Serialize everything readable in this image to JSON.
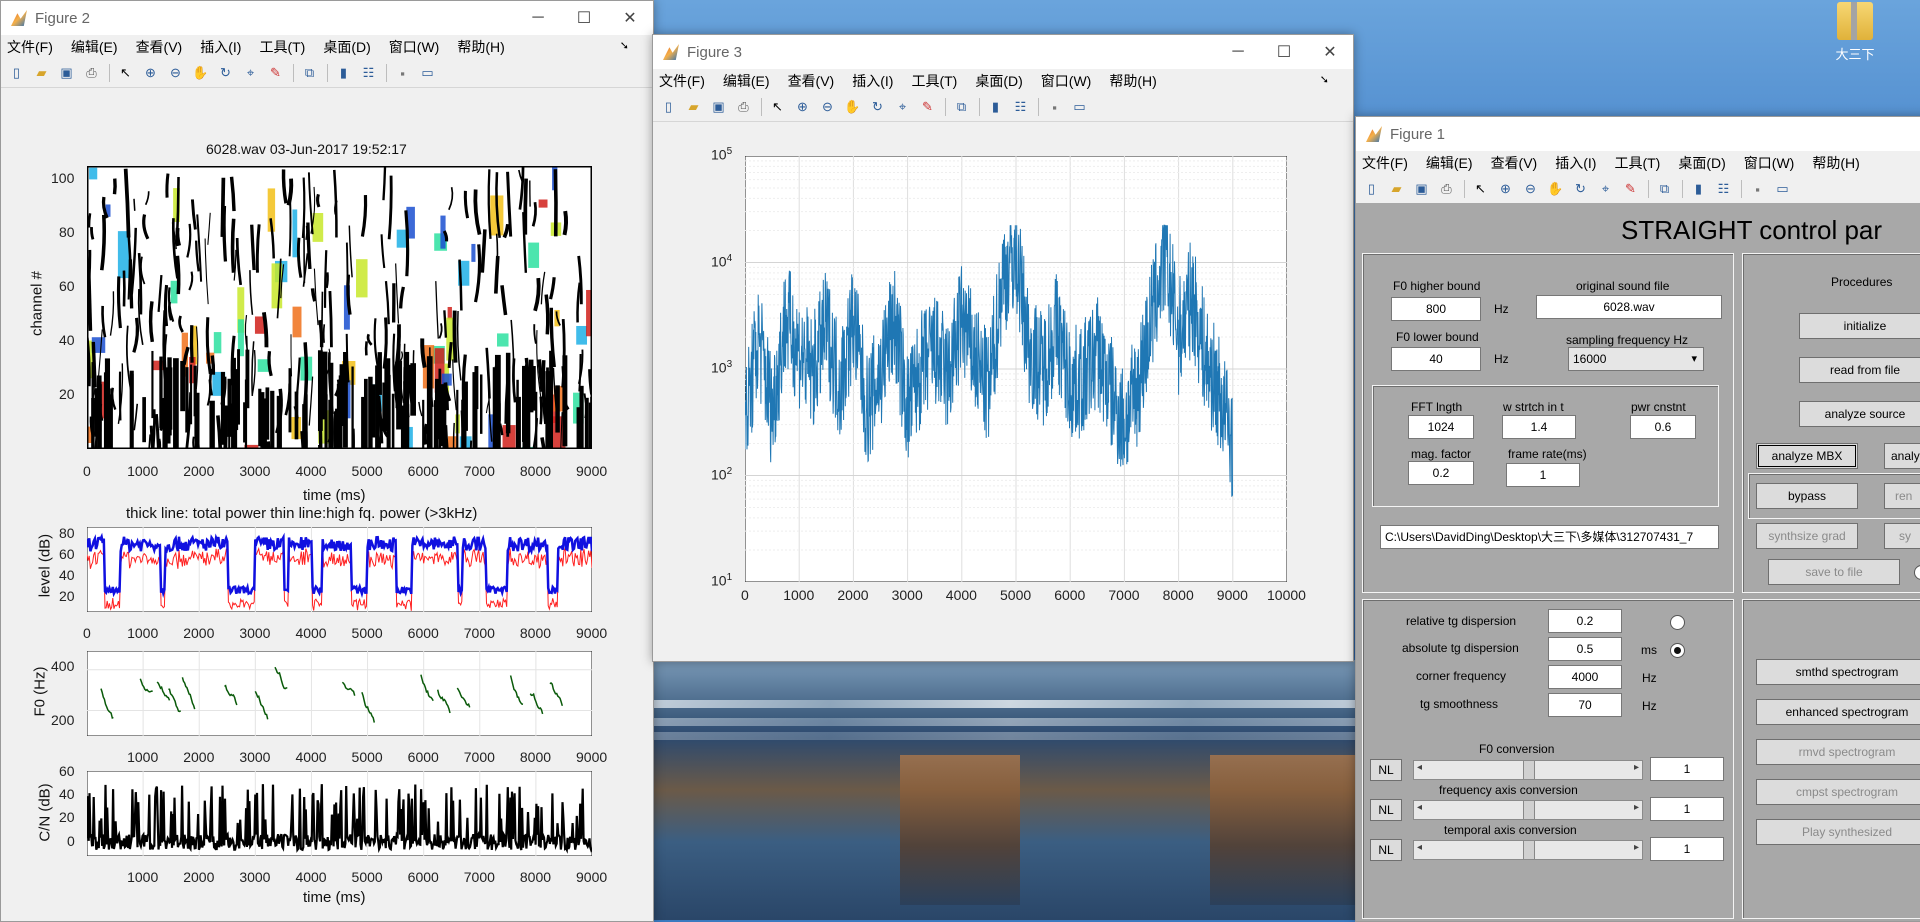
{
  "desktop": {
    "icon_label": "大三下"
  },
  "menus": [
    "文件(F)",
    "编辑(E)",
    "查看(V)",
    "插入(I)",
    "工具(T)",
    "桌面(D)",
    "窗口(W)",
    "帮助(H)"
  ],
  "figure2": {
    "title": "Figure 2",
    "spectrogram": {
      "title": "6028.wav  03-Jun-2017 19:52:17",
      "ylabel": "channel #",
      "xlabel": "time (ms)",
      "yticks": [
        "100",
        "80",
        "60",
        "40",
        "20"
      ],
      "xticks": [
        "0",
        "1000",
        "2000",
        "3000",
        "4000",
        "5000",
        "6000",
        "7000",
        "8000",
        "9000"
      ]
    },
    "power": {
      "title": "thick line: total power thin line:high fq. power (>3kHz)",
      "ylabel": "level (dB)",
      "yticks": [
        "80",
        "60",
        "40",
        "20"
      ],
      "xticks": [
        "0",
        "1000",
        "2000",
        "3000",
        "4000",
        "5000",
        "6000",
        "7000",
        "8000",
        "9000"
      ]
    },
    "f0": {
      "ylabel": "F0 (Hz)",
      "yticks": [
        "400",
        "200"
      ],
      "xticks": [
        "1000",
        "2000",
        "3000",
        "4000",
        "5000",
        "6000",
        "7000",
        "8000",
        "9000"
      ]
    },
    "cn": {
      "ylabel": "C/N (dB)",
      "xlabel": "time (ms)",
      "yticks": [
        "60",
        "40",
        "20",
        "0"
      ],
      "xticks": [
        "1000",
        "2000",
        "3000",
        "4000",
        "5000",
        "6000",
        "7000",
        "8000",
        "9000"
      ]
    }
  },
  "figure3": {
    "title": "Figure 3",
    "plot": {
      "yticks": [
        {
          "base": "10",
          "exp": "5"
        },
        {
          "base": "10",
          "exp": "4"
        },
        {
          "base": "10",
          "exp": "3"
        },
        {
          "base": "10",
          "exp": "2"
        },
        {
          "base": "10",
          "exp": "1"
        }
      ],
      "xticks": [
        "0",
        "1000",
        "2000",
        "3000",
        "4000",
        "5000",
        "6000",
        "7000",
        "8000",
        "9000",
        "10000"
      ]
    }
  },
  "chart_data": {
    "type": "line",
    "x_range": [
      0,
      9000
    ],
    "xlim": [
      0,
      10000
    ],
    "ylim": [
      10,
      100000
    ],
    "yscale": "log",
    "grid": true,
    "color": "#1f77b4",
    "x": [
      0,
      250,
      500,
      750,
      1000,
      1250,
      1500,
      1750,
      2000,
      2250,
      2500,
      2750,
      3000,
      3250,
      3500,
      3750,
      4000,
      4250,
      4500,
      4750,
      5000,
      5250,
      5500,
      5750,
      6000,
      6250,
      6500,
      6750,
      7000,
      7250,
      7500,
      7750,
      8000,
      8250,
      8500,
      8750,
      9000
    ],
    "y": [
      300,
      2000,
      400,
      3000,
      1500,
      900,
      2500,
      700,
      3000,
      400,
      900,
      3000,
      400,
      1000,
      1500,
      800,
      3000,
      1200,
      600,
      7000,
      12000,
      1500,
      1000,
      2500,
      700,
      800,
      1500,
      600,
      300,
      700,
      3000,
      12000,
      2000,
      5000,
      1200,
      600,
      200
    ]
  },
  "figure1": {
    "title": "Figure 1",
    "heading": "STRAIGHT control par",
    "f0_higher_label": "F0 higher bound",
    "f0_higher_value": "800",
    "f0_lower_label": "F0 lower bound",
    "f0_lower_value": "40",
    "hz": "Hz",
    "original_file_label": "original sound file",
    "original_file_value": "6028.wav",
    "sampling_label": "sampling frequency Hz",
    "sampling_value": "16000",
    "fft_label": "FFT lngth",
    "fft_value": "1024",
    "wstretch_label": "w strtch in t",
    "wstretch_value": "1.4",
    "pwr_label": "pwr cnstnt",
    "pwr_value": "0.6",
    "mag_label": "mag. factor",
    "mag_value": "0.2",
    "frame_label": "frame rate(ms)",
    "frame_value": "1",
    "path_value": "C:\\Users\\DavidDing\\Desktop\\大三下\\多媒体\\312707431_7",
    "rel_tg_label": "relative tg dispersion",
    "rel_tg_value": "0.2",
    "abs_tg_label": "absolute tg dispersion",
    "abs_tg_value": "0.5",
    "ms": "ms",
    "corner_label": "corner frequency",
    "corner_value": "4000",
    "smooth_label": "tg smoothness",
    "smooth_value": "70",
    "f0conv_label": "F0 conversion",
    "freqconv_label": "frequency axis conversion",
    "tempconv_label": "temporal axis conversion",
    "nl": "NL",
    "conv_value": "1",
    "procedures_label": "Procedures",
    "btn_initialize": "initialize",
    "btn_read": "read from file",
    "btn_analyze_source": "analyze source",
    "btn_analyze_mbx": "analyze MBX",
    "btn_analy": "analy",
    "btn_bypass": "bypass",
    "btn_ren": "ren",
    "btn_synth_grad": "synthsize grad",
    "btn_sy": "sy",
    "btn_save": "save to file",
    "btn_smthd": "smthd spectrogram",
    "btn_enhanced": "enhanced spectrogram",
    "btn_rmvd": "rmvd spectrogram",
    "btn_cmpst": "cmpst spectrogram",
    "btn_play": "Play synthesized"
  }
}
